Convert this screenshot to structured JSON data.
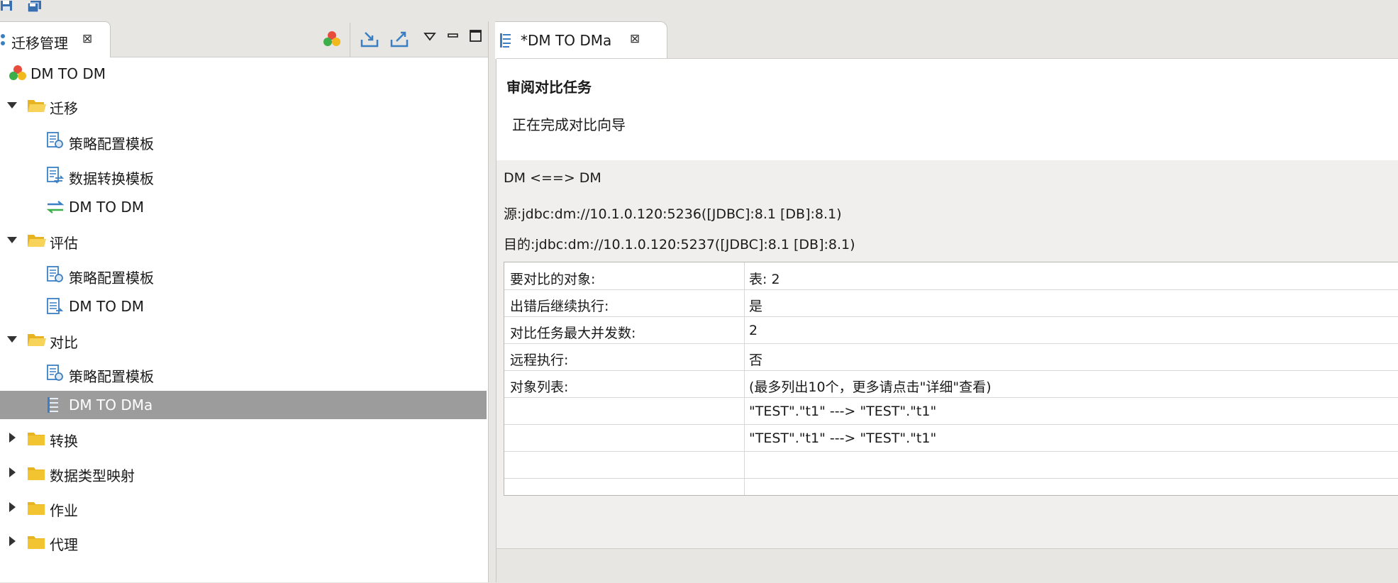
{
  "left_view": {
    "tab_title": "迁移管理",
    "tree": [
      {
        "label": "DM TO DM",
        "icon": "database-group-icon"
      },
      {
        "label": "迁移",
        "icon": "folder-open-icon"
      },
      {
        "label": "策略配置模板",
        "icon": "policy-template-icon"
      },
      {
        "label": "数据转换模板",
        "icon": "data-convert-template-icon"
      },
      {
        "label": "DM TO DM",
        "icon": "migration-arrows-icon"
      },
      {
        "label": "评估",
        "icon": "folder-open-icon"
      },
      {
        "label": "策略配置模板",
        "icon": "policy-template-icon"
      },
      {
        "label": "DM TO DM",
        "icon": "assessment-doc-icon"
      },
      {
        "label": "对比",
        "icon": "folder-open-icon"
      },
      {
        "label": "策略配置模板",
        "icon": "policy-template-icon"
      },
      {
        "label": "DM TO DMa",
        "icon": "compare-doc-icon"
      },
      {
        "label": "转换",
        "icon": "folder-closed-icon"
      },
      {
        "label": "数据类型映射",
        "icon": "folder-closed-icon"
      },
      {
        "label": "作业",
        "icon": "folder-closed-icon"
      },
      {
        "label": "代理",
        "icon": "folder-closed-icon"
      }
    ]
  },
  "editor": {
    "tab_title": "*DM TO DMa",
    "header_title": "审阅对比任务",
    "header_subtitle": "正在完成对比向导",
    "summary_line": "DM <==> DM",
    "source_line": "源:jdbc:dm://10.1.0.120:5236([JDBC]:8.1 [DB]:8.1)",
    "target_line": "目的:jdbc:dm://10.1.0.120:5237([JDBC]:8.1 [DB]:8.1)",
    "rows": [
      {
        "key": "要对比的对象:",
        "value": "表: 2"
      },
      {
        "key": "出错后继续执行:",
        "value": "是"
      },
      {
        "key": "对比任务最大并发数:",
        "value": "2"
      },
      {
        "key": "远程执行:",
        "value": "否"
      },
      {
        "key": "对象列表:",
        "value": "(最多列出10个，更多请点击\"详细\"查看)"
      },
      {
        "key": "",
        "value": "\"TEST\".\"t1\" ---> \"TEST\".\"t1\""
      },
      {
        "key": "",
        "value": "\"TEST\".\"t1\" ---> \"TEST\".\"t1\""
      },
      {
        "key": "",
        "value": ""
      }
    ]
  },
  "colors": {
    "selection": "#9c9c9c",
    "folder": "#e8b321",
    "toolbar_blue": "#3a7fc4"
  }
}
